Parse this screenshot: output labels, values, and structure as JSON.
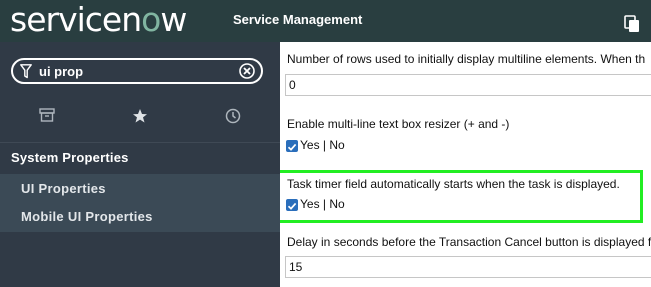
{
  "header": {
    "logo_pre": "servicen",
    "logo_o": "o",
    "logo_post": "w",
    "app_title": "Service Management",
    "logo_accent_color": "#81b5a1"
  },
  "sidebar": {
    "search": {
      "value": "ui prop"
    },
    "tabs": [
      {
        "icon": "archive-icon"
      },
      {
        "icon": "star-icon"
      },
      {
        "icon": "clock-icon"
      }
    ],
    "section_title": "System Properties",
    "modules": [
      {
        "label": "UI Properties"
      },
      {
        "label": "Mobile UI Properties"
      }
    ]
  },
  "main": {
    "properties": [
      {
        "label": "Number of rows used to initially display multiline elements. When th",
        "value": "0"
      },
      {
        "label": "Enable multi-line text box resizer (+ and -)",
        "checkbox_label": "Yes | No",
        "checked": true
      },
      {
        "label": "Task timer field automatically starts when the task is displayed.",
        "checkbox_label": "Yes | No",
        "checked": true,
        "highlighted": true
      },
      {
        "label": "Delay in seconds before the Transaction Cancel button is displayed f",
        "value": "15"
      }
    ],
    "highlight_color": "#22ee22"
  }
}
